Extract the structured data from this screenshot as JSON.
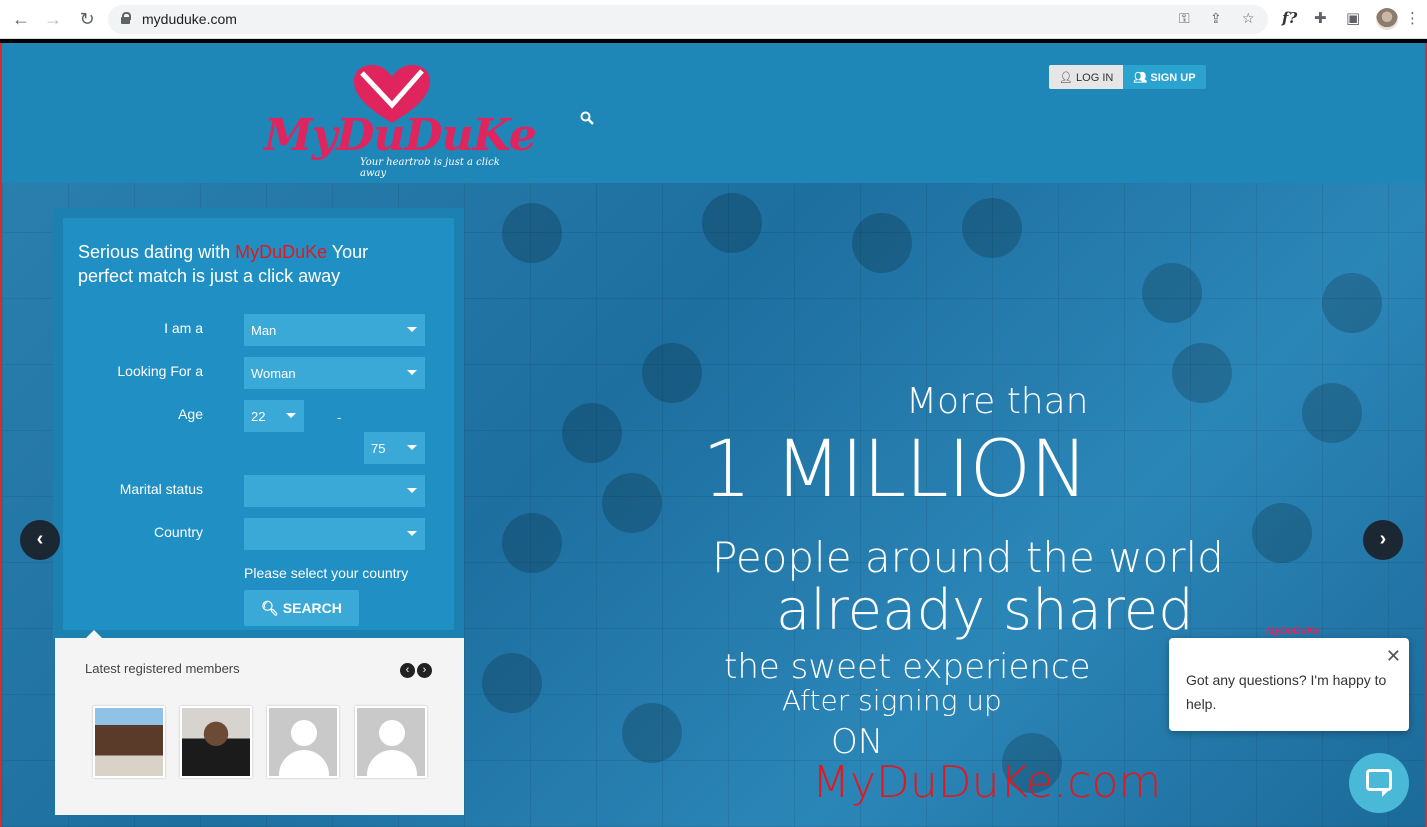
{
  "browser": {
    "url": "myduduke.com"
  },
  "header": {
    "logo": {
      "brand": "MyDuDuKe",
      "tagline": "Your heartrob is just a click away"
    },
    "auth": {
      "login": "LOG IN",
      "signup": "SIGN UP"
    }
  },
  "search_panel": {
    "title_prefix": "Serious dating with ",
    "title_brand": "MyDuDuKe",
    "title_suffix": " Your perfect match is just a click away",
    "fields": {
      "i_am": {
        "label": "I am a",
        "value": "Man"
      },
      "looking_for": {
        "label": "Looking For a",
        "value": "Woman"
      },
      "age": {
        "label": "Age",
        "from": "22",
        "separator": "-",
        "to": "75"
      },
      "marital_status": {
        "label": "Marital status",
        "value": ""
      },
      "country": {
        "label": "Country",
        "value": ""
      }
    },
    "hint": "Please select your country",
    "search_button": "SEARCH"
  },
  "members": {
    "title": "Latest registered members"
  },
  "headline": {
    "line1": "More than",
    "line2": "1 MILLION",
    "line3": "People around the world",
    "line4": "already shared",
    "line5": "the sweet experience",
    "line6": "After signing up",
    "line7": "ON",
    "line8": "MyDuDuKe.com"
  },
  "chat": {
    "message": "Got any questions? I'm happy to help.",
    "badge": "MyDuDuKe"
  },
  "colors": {
    "brand_red": "#e3181e",
    "brand_pink": "#e0245e",
    "hero_blue": "#1a7fb0",
    "panel_blue": "#1f8fc4"
  }
}
